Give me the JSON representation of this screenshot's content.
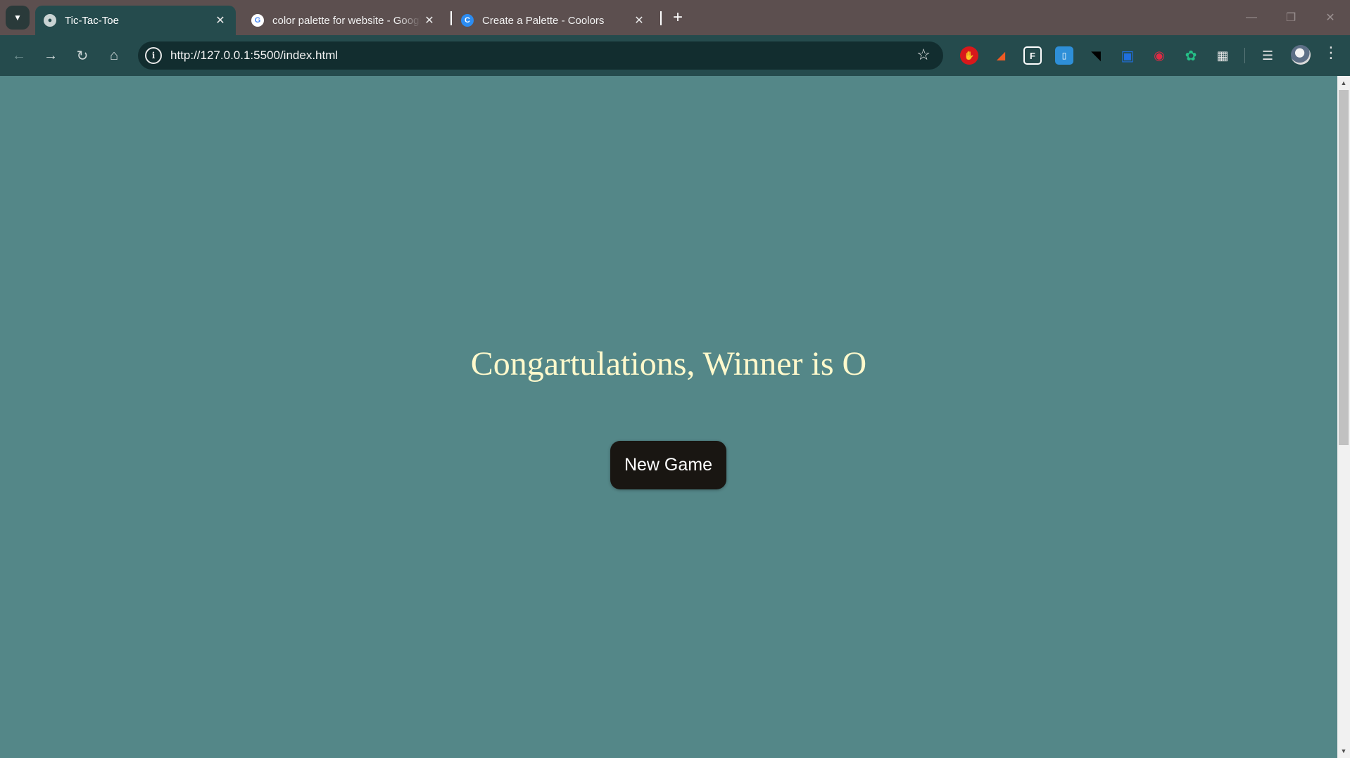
{
  "browser": {
    "tabs": [
      {
        "title": "Tic-Tac-Toe",
        "favicon": "globe-icon",
        "active": true
      },
      {
        "title": "color palette for website - Google Search",
        "favicon": "google-icon",
        "active": false
      },
      {
        "title": "Create a Palette - Coolors",
        "favicon": "coolors-icon",
        "active": false
      }
    ],
    "url": "http://127.0.0.1:5500/index.html",
    "extensions": [
      "adblock-hand-icon",
      "office-icon",
      "puzzle-f-icon",
      "clipboard-icon",
      "shoe-icon",
      "trello-icon",
      "record-icon",
      "chatgpt-icon",
      "extensions-puzzle-icon"
    ],
    "colors": {
      "tabstrip": "#5c4f4f",
      "toolbar": "#254b4d",
      "omnibox": "#122d2f"
    }
  },
  "page": {
    "message": "Congartulations, Winner is O",
    "new_game_label": "New Game",
    "colors": {
      "background": "#548788",
      "message_text": "#fff9cc",
      "button_bg": "#191612",
      "button_text": "#ffffff"
    }
  }
}
